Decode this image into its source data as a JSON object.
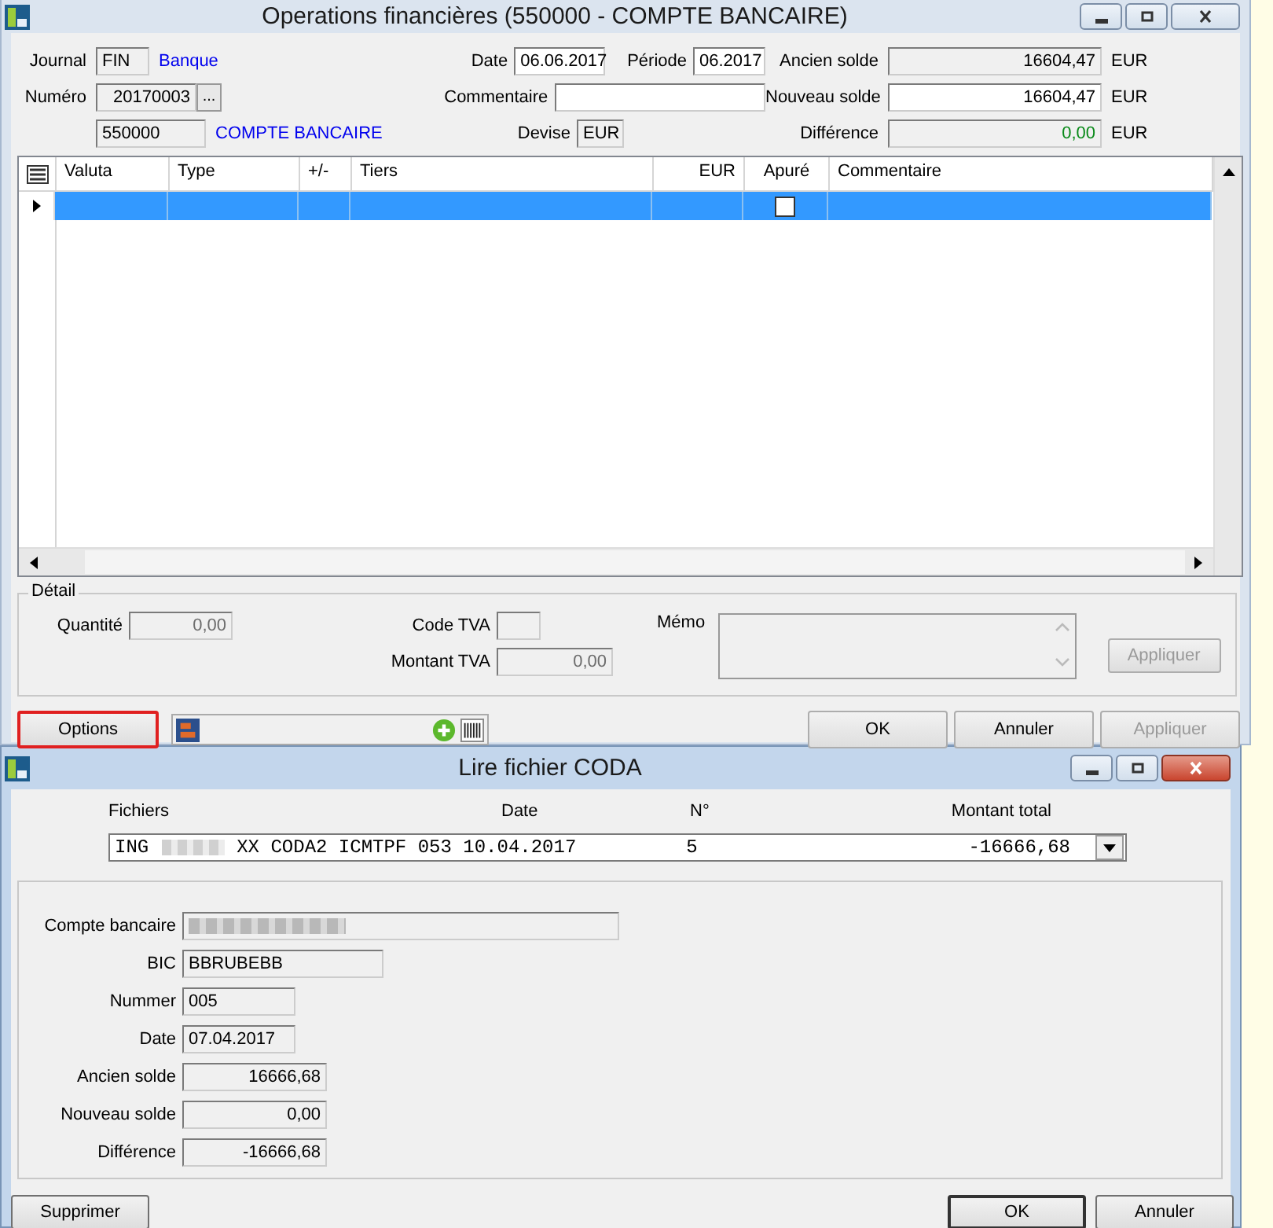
{
  "window": {
    "title": "Operations financières (550000 - COMPTE BANCAIRE)"
  },
  "header": {
    "journal_label": "Journal",
    "journal": "FIN",
    "journal_name": "Banque",
    "numero_label": "Numéro",
    "numero": "20170003",
    "numero_button": "...",
    "account": "550000",
    "account_name": "COMPTE BANCAIRE",
    "date_label": "Date",
    "date": "06.06.2017",
    "periode_label": "Période",
    "periode": "06.2017",
    "commentaire_label": "Commentaire",
    "devise_label": "Devise",
    "devise": "EUR",
    "ancien_label": "Ancien solde",
    "ancien": "16604,47",
    "nouveau_label": "Nouveau solde",
    "nouveau": "16604,47",
    "difference_label": "Différence",
    "difference": "0,00",
    "ancien_currency": "EUR",
    "nouveau_currency": "EUR",
    "difference_currency": "EUR"
  },
  "grid": {
    "columns": [
      "Valuta",
      "Type",
      "+/-",
      "Tiers",
      "EUR",
      "Apuré",
      "Commentaire"
    ],
    "rows": [
      {
        "selected": true,
        "apure": false
      }
    ]
  },
  "detail": {
    "legend": "Détail",
    "quantite_label": "Quantité",
    "quantite": "0,00",
    "code_tva_label": "Code TVA",
    "montant_tva_label": "Montant TVA",
    "montant_tva": "0,00",
    "memo_label": "Mémo",
    "apply_button": {
      "label": "Appliquer",
      "disabled": true
    }
  },
  "footer": {
    "options_button": {
      "label": "Options",
      "highlighted": true
    },
    "buttons": [
      {
        "label": "OK",
        "disabled": false
      },
      {
        "label": "Annuler",
        "disabled": false
      },
      {
        "label": "Appliquer",
        "disabled": true
      }
    ]
  },
  "dialog": {
    "title": "Lire fichier CODA",
    "columns": [
      "Fichiers",
      "Date",
      "N°",
      "Montant total"
    ],
    "file": {
      "bank": "ING",
      "name": "XX CODA2 ICMTPF 053 10.04.2017",
      "number": "5",
      "amount": "-16666,68"
    },
    "fields": [
      {
        "label": "Compte bancaire",
        "kind": "redacted"
      },
      {
        "label": "BIC",
        "value": "BBRUBEBB",
        "kind": "text"
      },
      {
        "label": "Nummer",
        "value": "005",
        "kind": "text"
      },
      {
        "label": "Date",
        "value": "07.04.2017",
        "kind": "text"
      },
      {
        "label": "Ancien solde",
        "value": "16666,68",
        "kind": "amount"
      },
      {
        "label": "Nouveau solde",
        "value": "0,00",
        "kind": "amount"
      },
      {
        "label": "Différence",
        "value": "-16666,68",
        "kind": "amount"
      }
    ],
    "buttons": [
      {
        "label": "Supprimer",
        "default": false
      },
      {
        "label": "OK",
        "default": true
      },
      {
        "label": "Annuler",
        "default": false
      }
    ]
  }
}
